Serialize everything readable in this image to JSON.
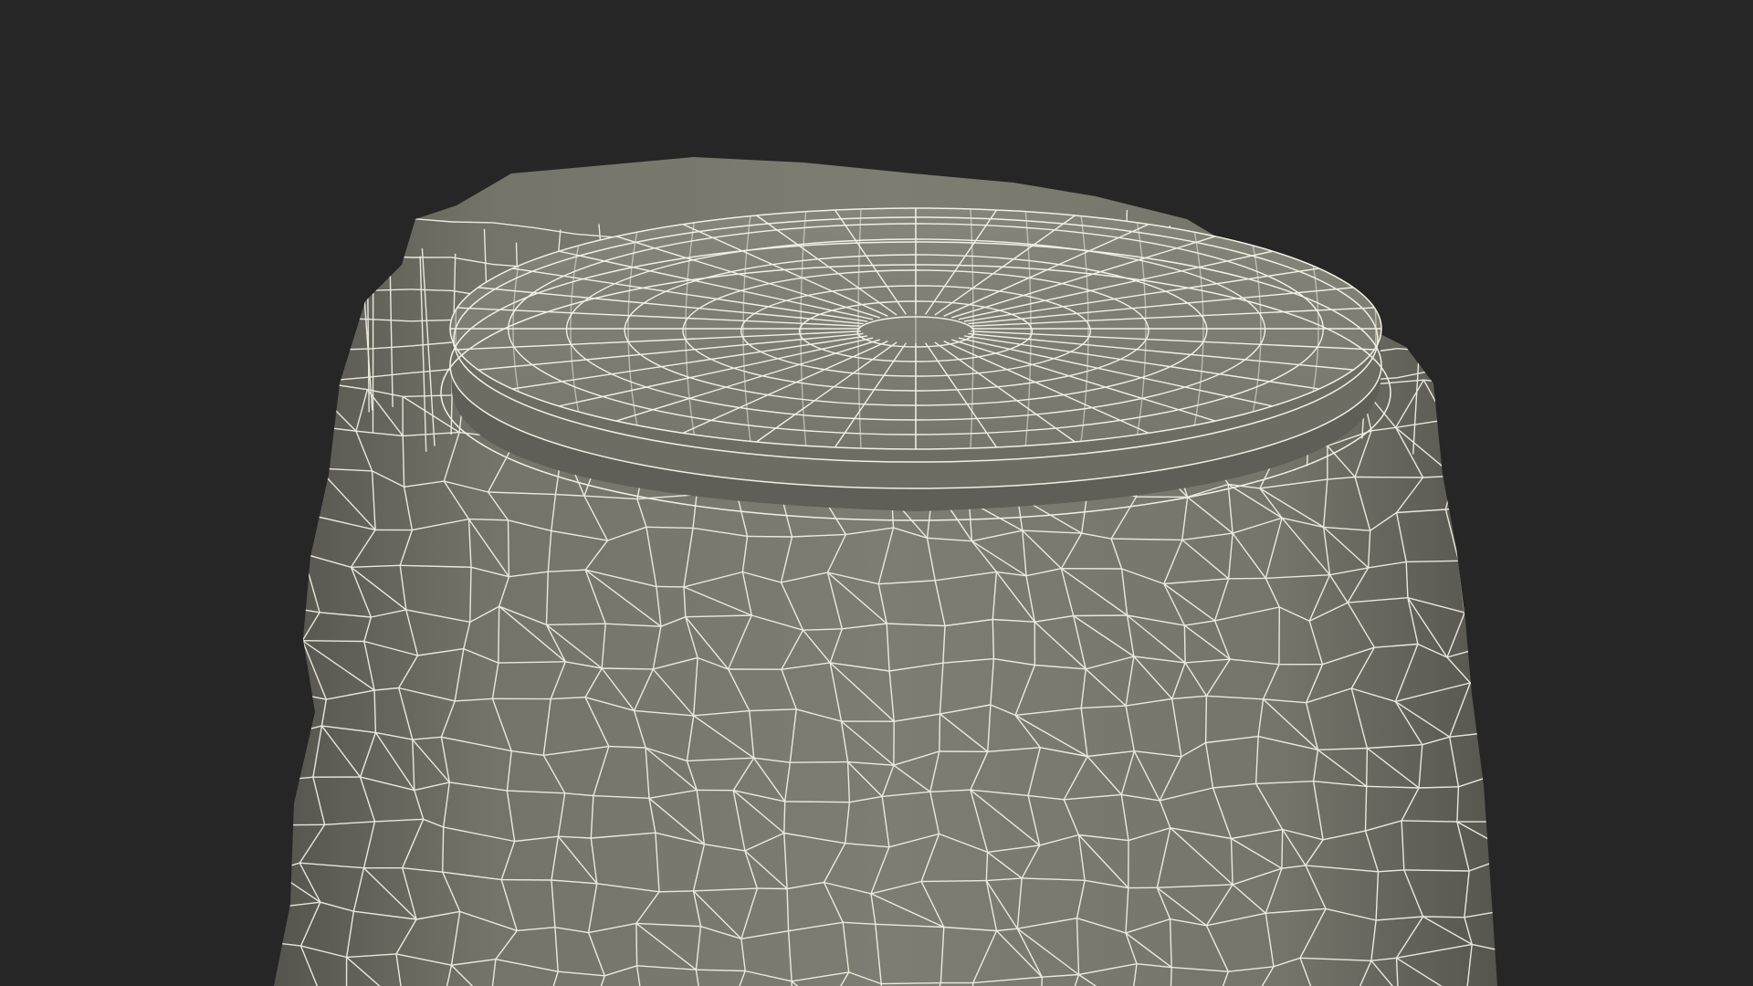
{
  "viewport": {
    "background_color": "#262626",
    "object": "wireframe-render",
    "object_subject": "sack-covered-jar-lid",
    "mesh_color": "#7a7a6f",
    "mesh_shadow_color": "#5f5f57",
    "wire_color": "#f2f0e4"
  }
}
